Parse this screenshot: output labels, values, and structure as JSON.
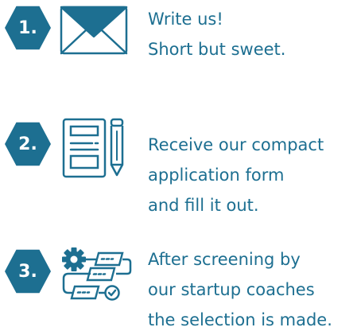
{
  "colors": {
    "badge": "#1d6f91",
    "icon": "#1d6f91",
    "text": "#1d6f91"
  },
  "steps": [
    {
      "number": "1.",
      "icon": "envelope-icon",
      "lines": [
        "Write us!",
        "Short but sweet."
      ]
    },
    {
      "number": "2.",
      "icon": "form-and-pencil-icon",
      "lines": [
        "Receive our compact",
        "application form",
        "and fill it out."
      ]
    },
    {
      "number": "3.",
      "icon": "workflow-gear-icon",
      "lines": [
        "After screening by",
        "our startup coaches",
        "the selection is made."
      ]
    }
  ]
}
